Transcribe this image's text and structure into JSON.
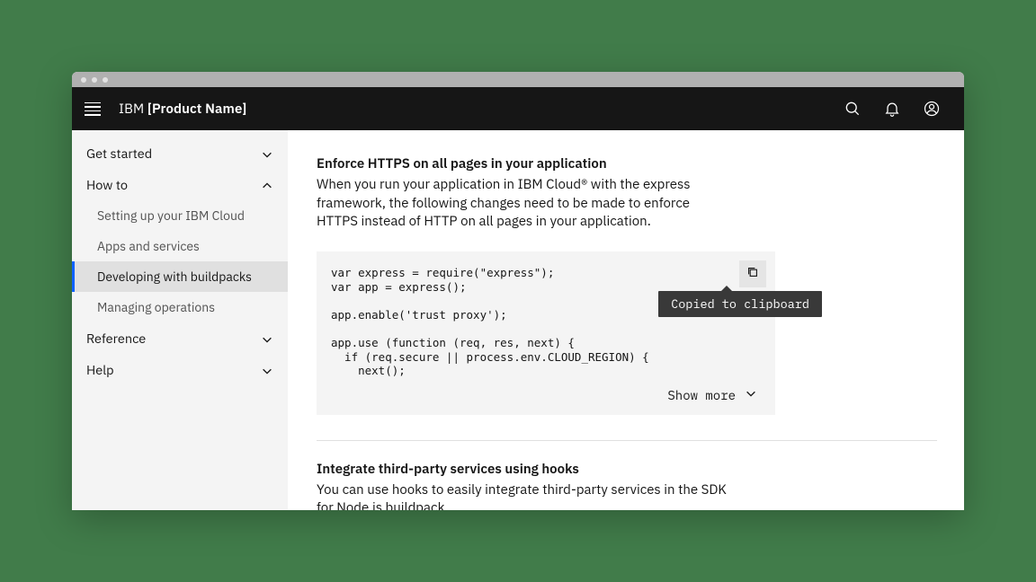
{
  "header": {
    "brand_prefix": "IBM ",
    "brand_product": "[Product Name]"
  },
  "sidebar": {
    "groups": [
      {
        "label": "Get started",
        "expanded": false
      },
      {
        "label": "How to",
        "expanded": true,
        "items": [
          {
            "label": "Setting up your IBM Cloud"
          },
          {
            "label": "Apps and services"
          },
          {
            "label": "Developing with buildpacks",
            "active": true
          },
          {
            "label": "Managing operations"
          }
        ]
      },
      {
        "label": "Reference",
        "expanded": false
      },
      {
        "label": "Help",
        "expanded": false
      }
    ]
  },
  "content": {
    "https": {
      "title": "Enforce HTTPS on all pages in your application",
      "para": "When you run your application in IBM Cloud® with the express framework, the following changes need to be made to enforce HTTPS instead of HTTP on all pages in your application.",
      "code": "var express = require(\"express\");\nvar app = express();\n\napp.enable('trust proxy');\n\napp.use (function (req, res, next) {\n  if (req.secure || process.env.CLOUD_REGION) {\n    next();",
      "copy_tooltip": "Copied to clipboard",
      "show_more": "Show more"
    },
    "hooks": {
      "title": "Integrate third-party services using hooks",
      "para": "You can use hooks to easily integrate third-party services in the SDK for Node.js buildpack."
    }
  }
}
